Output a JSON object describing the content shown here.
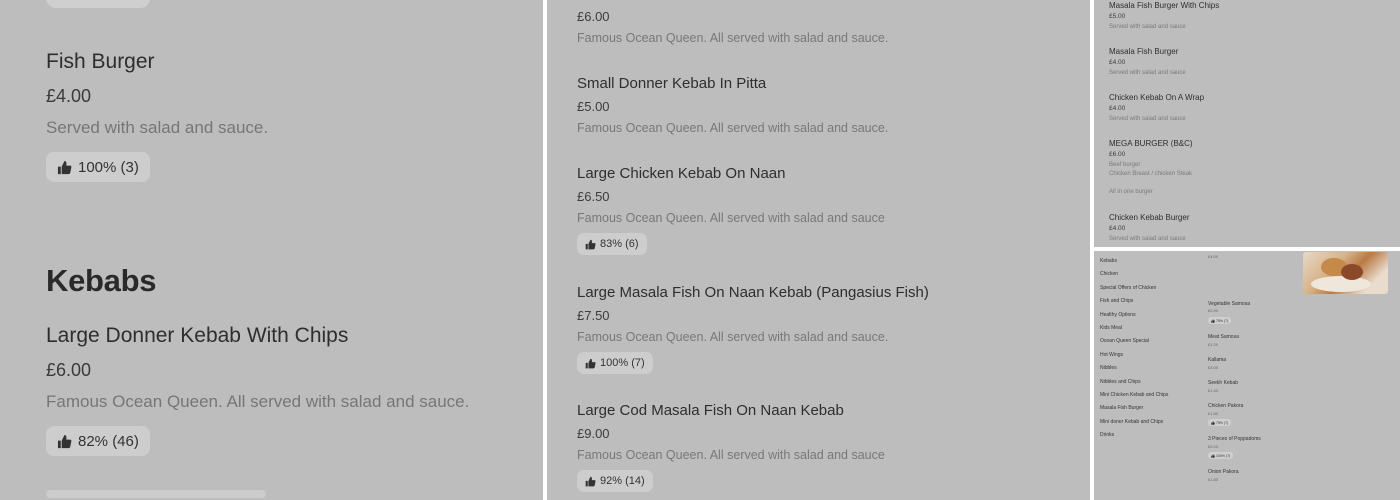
{
  "rating_icon": "thumbs-up-icon",
  "panel1": {
    "items": [
      {
        "name": "Fish Burger",
        "price": "£4.00",
        "desc": "Served with salad and sauce.",
        "rating": "100% (3)"
      },
      {
        "name": "Large Donner Kebab With Chips",
        "price": "£6.00",
        "desc": "Famous Ocean Queen. All served with salad and sauce.",
        "rating": "82% (46)"
      }
    ],
    "heading": "Kebabs"
  },
  "panel2": {
    "items": [
      {
        "name": "",
        "price": "£6.00",
        "desc": "Famous Ocean Queen. All served with salad and sauce.",
        "rating": ""
      },
      {
        "name": "Small Donner Kebab In Pitta",
        "price": "£5.00",
        "desc": "Famous Ocean Queen. All served with salad and sauce.",
        "rating": ""
      },
      {
        "name": "Large Chicken Kebab On Naan",
        "price": "£6.50",
        "desc": "Famous Ocean Queen. All served with salad and sauce",
        "rating": "83% (6)"
      },
      {
        "name": "Large Masala Fish On Naan Kebab (Pangasius Fish)",
        "price": "£7.50",
        "desc": "Famous Ocean Queen. All served with salad and sauce.",
        "rating": "100% (7)"
      },
      {
        "name": "Large Cod Masala Fish On Naan Kebab",
        "price": "£9.00",
        "desc": "Famous Ocean Queen. All served with salad and sauce",
        "rating": "92% (14)"
      }
    ]
  },
  "panel3": {
    "items": [
      {
        "name": "Masala Fish Burger With Chips",
        "price": "£5.00",
        "desc": "Served with salad and sauce"
      },
      {
        "name": "Masala Fish Burger",
        "price": "£4.00",
        "desc": "Served with salad and sauce"
      },
      {
        "name": "Chicken Kebab On A Wrap",
        "price": "£4.00",
        "desc": "Served with salad and sauce"
      },
      {
        "name": "MEGA BURGER (B&C)",
        "price": "£6.00",
        "desc": "Beef burger",
        "desc2": "Chicken Breast / chicken Steak",
        "desc3": "All in one burger"
      },
      {
        "name": "Chicken Kebab Burger",
        "price": "£4.00",
        "desc": "Served with salad and sauce"
      }
    ]
  },
  "panel4": {
    "categories": [
      "Kebabs",
      "Chicken",
      "Special Offers of Chicken",
      "Fish and Chips",
      "Healthy Options",
      "Kids Meal",
      "Ocean Queen Special",
      "Hot Wings",
      "Nibbles",
      "Nibbles and Chips",
      "Mini Chicken Kebab and Chips",
      "Masala Fish Burger",
      "Mini doner Kebab and Chips",
      "Drinks"
    ],
    "top_price": "£4.00",
    "items": [
      {
        "name": "Vegetable Samosa",
        "price": "£0.90",
        "rating": "75% (7)"
      },
      {
        "name": "Meat Samosa",
        "price": "£1.20",
        "rating": ""
      },
      {
        "name": "Kallama",
        "price": "£3.00",
        "rating": ""
      },
      {
        "name": "Seekh Kebab",
        "price": "£1.40",
        "rating": ""
      },
      {
        "name": "Chicken Pakora",
        "price": "£1.80",
        "rating": "75% (7)"
      },
      {
        "name": "3 Pieces of Poppadoms",
        "price": "£2.00",
        "rating": "100% (7)"
      },
      {
        "name": "Onion Pakora",
        "price": "£1.80",
        "rating": ""
      }
    ]
  }
}
